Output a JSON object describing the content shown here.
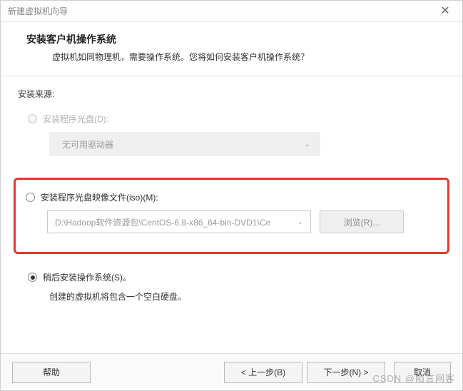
{
  "window": {
    "title": "新建虚拟机向导",
    "close_glyph": "✕"
  },
  "header": {
    "title": "安装客户机操作系统",
    "subtitle": "虚拟机如同物理机，需要操作系统。您将如何安装客户机操作系统？"
  },
  "source_label": "安装来源:",
  "opt_disc": {
    "label": "安装程序光盘(D):",
    "combo_text": "无可用驱动器"
  },
  "opt_iso": {
    "label": "安装程序光盘映像文件(iso)(M):",
    "combo_text": "D:\\Hadoop软件资源包\\CentOS-6.8-x86_64-bin-DVD1\\Ce",
    "browse_label": "浏览(R)..."
  },
  "opt_later": {
    "label": "稍后安装操作系统(S)。",
    "hint": "创建的虚拟机将包含一个空白硬盘。"
  },
  "footer": {
    "help": "帮助",
    "back": "< 上一步(B)",
    "next": "下一步(N) >",
    "cancel": "取消"
  },
  "watermark": "CSDN @陌言网客"
}
